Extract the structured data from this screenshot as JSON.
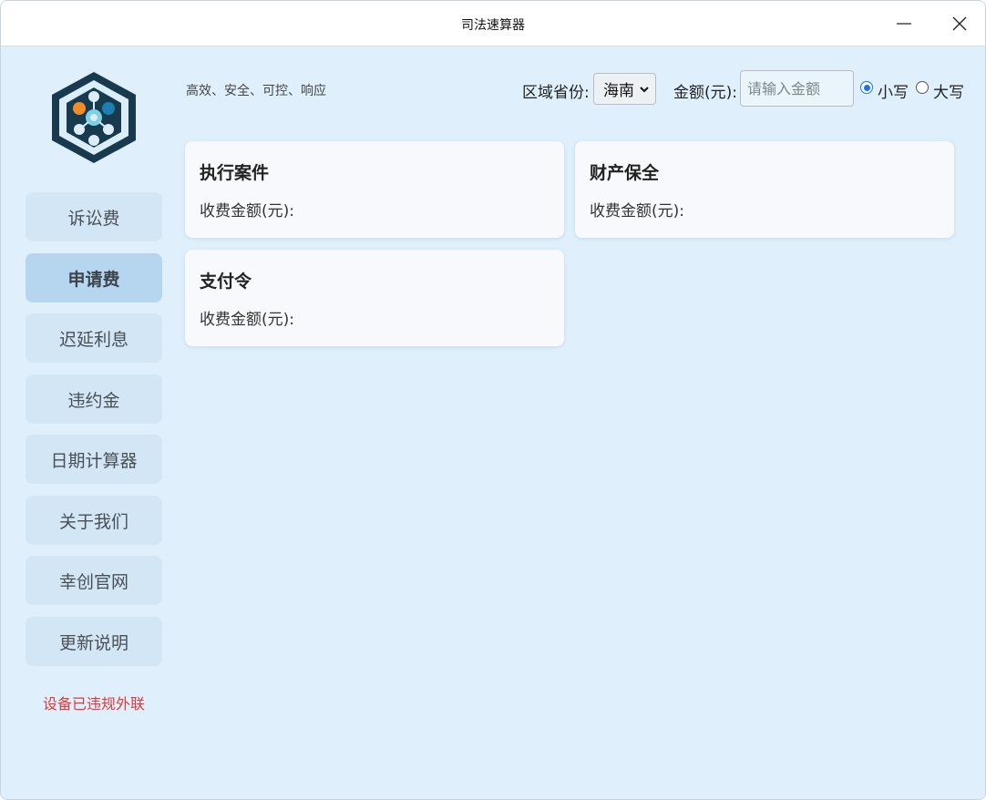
{
  "window": {
    "title": "司法速算器"
  },
  "sidebar": {
    "items": [
      {
        "label": "诉讼费",
        "active": false
      },
      {
        "label": "申请费",
        "active": true
      },
      {
        "label": "迟延利息",
        "active": false
      },
      {
        "label": "违约金",
        "active": false
      },
      {
        "label": "日期计算器",
        "active": false
      },
      {
        "label": "关于我们",
        "active": false
      },
      {
        "label": "幸创官网",
        "active": false
      },
      {
        "label": "更新说明",
        "active": false
      }
    ],
    "warning": "设备已违规外联"
  },
  "header": {
    "tagline": "高效、安全、可控、响应",
    "province_label": "区域省份:",
    "province_value": "海南",
    "amount_label": "金额(元):",
    "amount_placeholder": "请输入金额",
    "amount_value": "",
    "radio_lower": "小写",
    "radio_upper": "大写"
  },
  "cards": [
    {
      "title": "执行案件",
      "fee_label": "收费金额(元):"
    },
    {
      "title": "财产保全",
      "fee_label": "收费金额(元):"
    },
    {
      "title": "支付令",
      "fee_label": "收费金额(元):"
    }
  ],
  "colors": {
    "background": "#dff0fc",
    "nav_item": "#d3e6f6",
    "nav_active": "#b6d6f0",
    "warning": "#e03a3a",
    "radio_accent": "#1a73e8",
    "logo_dark": "#173a4f"
  },
  "icons": {
    "logo": "hexagon-logo-icon",
    "minimize": "minimize-icon",
    "close": "close-icon",
    "select": "chevron-down-icon"
  }
}
